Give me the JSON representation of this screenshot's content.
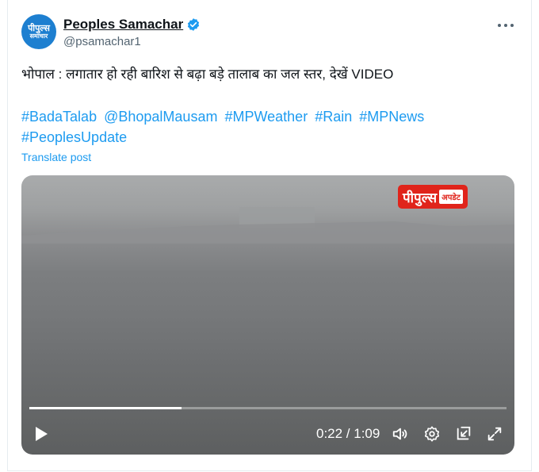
{
  "author": {
    "avatar_line1": "पीपुल्स",
    "avatar_line2": "समाचार",
    "display_name": "Peoples Samachar",
    "handle": "@psamachar1"
  },
  "post": {
    "text": "भोपाल : लगातार हो रही बारिश से बढ़ा बड़े तालाब का जल स्तर, देखें VIDEO",
    "hashtags": [
      "#BadaTalab",
      "@BhopalMausam",
      "#MPWeather",
      "#Rain",
      "#MPNews",
      "#PeoplesUpdate"
    ],
    "translate_label": "Translate post"
  },
  "video": {
    "watermark_main": "पीपुल्स",
    "watermark_sub": "अपडेट",
    "time_display": "0:22 / 1:09",
    "progress_fraction": 0.319
  },
  "icons": {
    "more": "more-icon",
    "verified": "verified-badge-icon",
    "play": "play-icon",
    "volume": "volume-icon",
    "settings": "settings-icon",
    "pip": "picture-in-picture-icon",
    "fullscreen": "fullscreen-icon"
  },
  "colors": {
    "accent": "#1d9bf0",
    "avatar_bg": "#1d7fd0",
    "watermark_red": "#e0241b"
  }
}
